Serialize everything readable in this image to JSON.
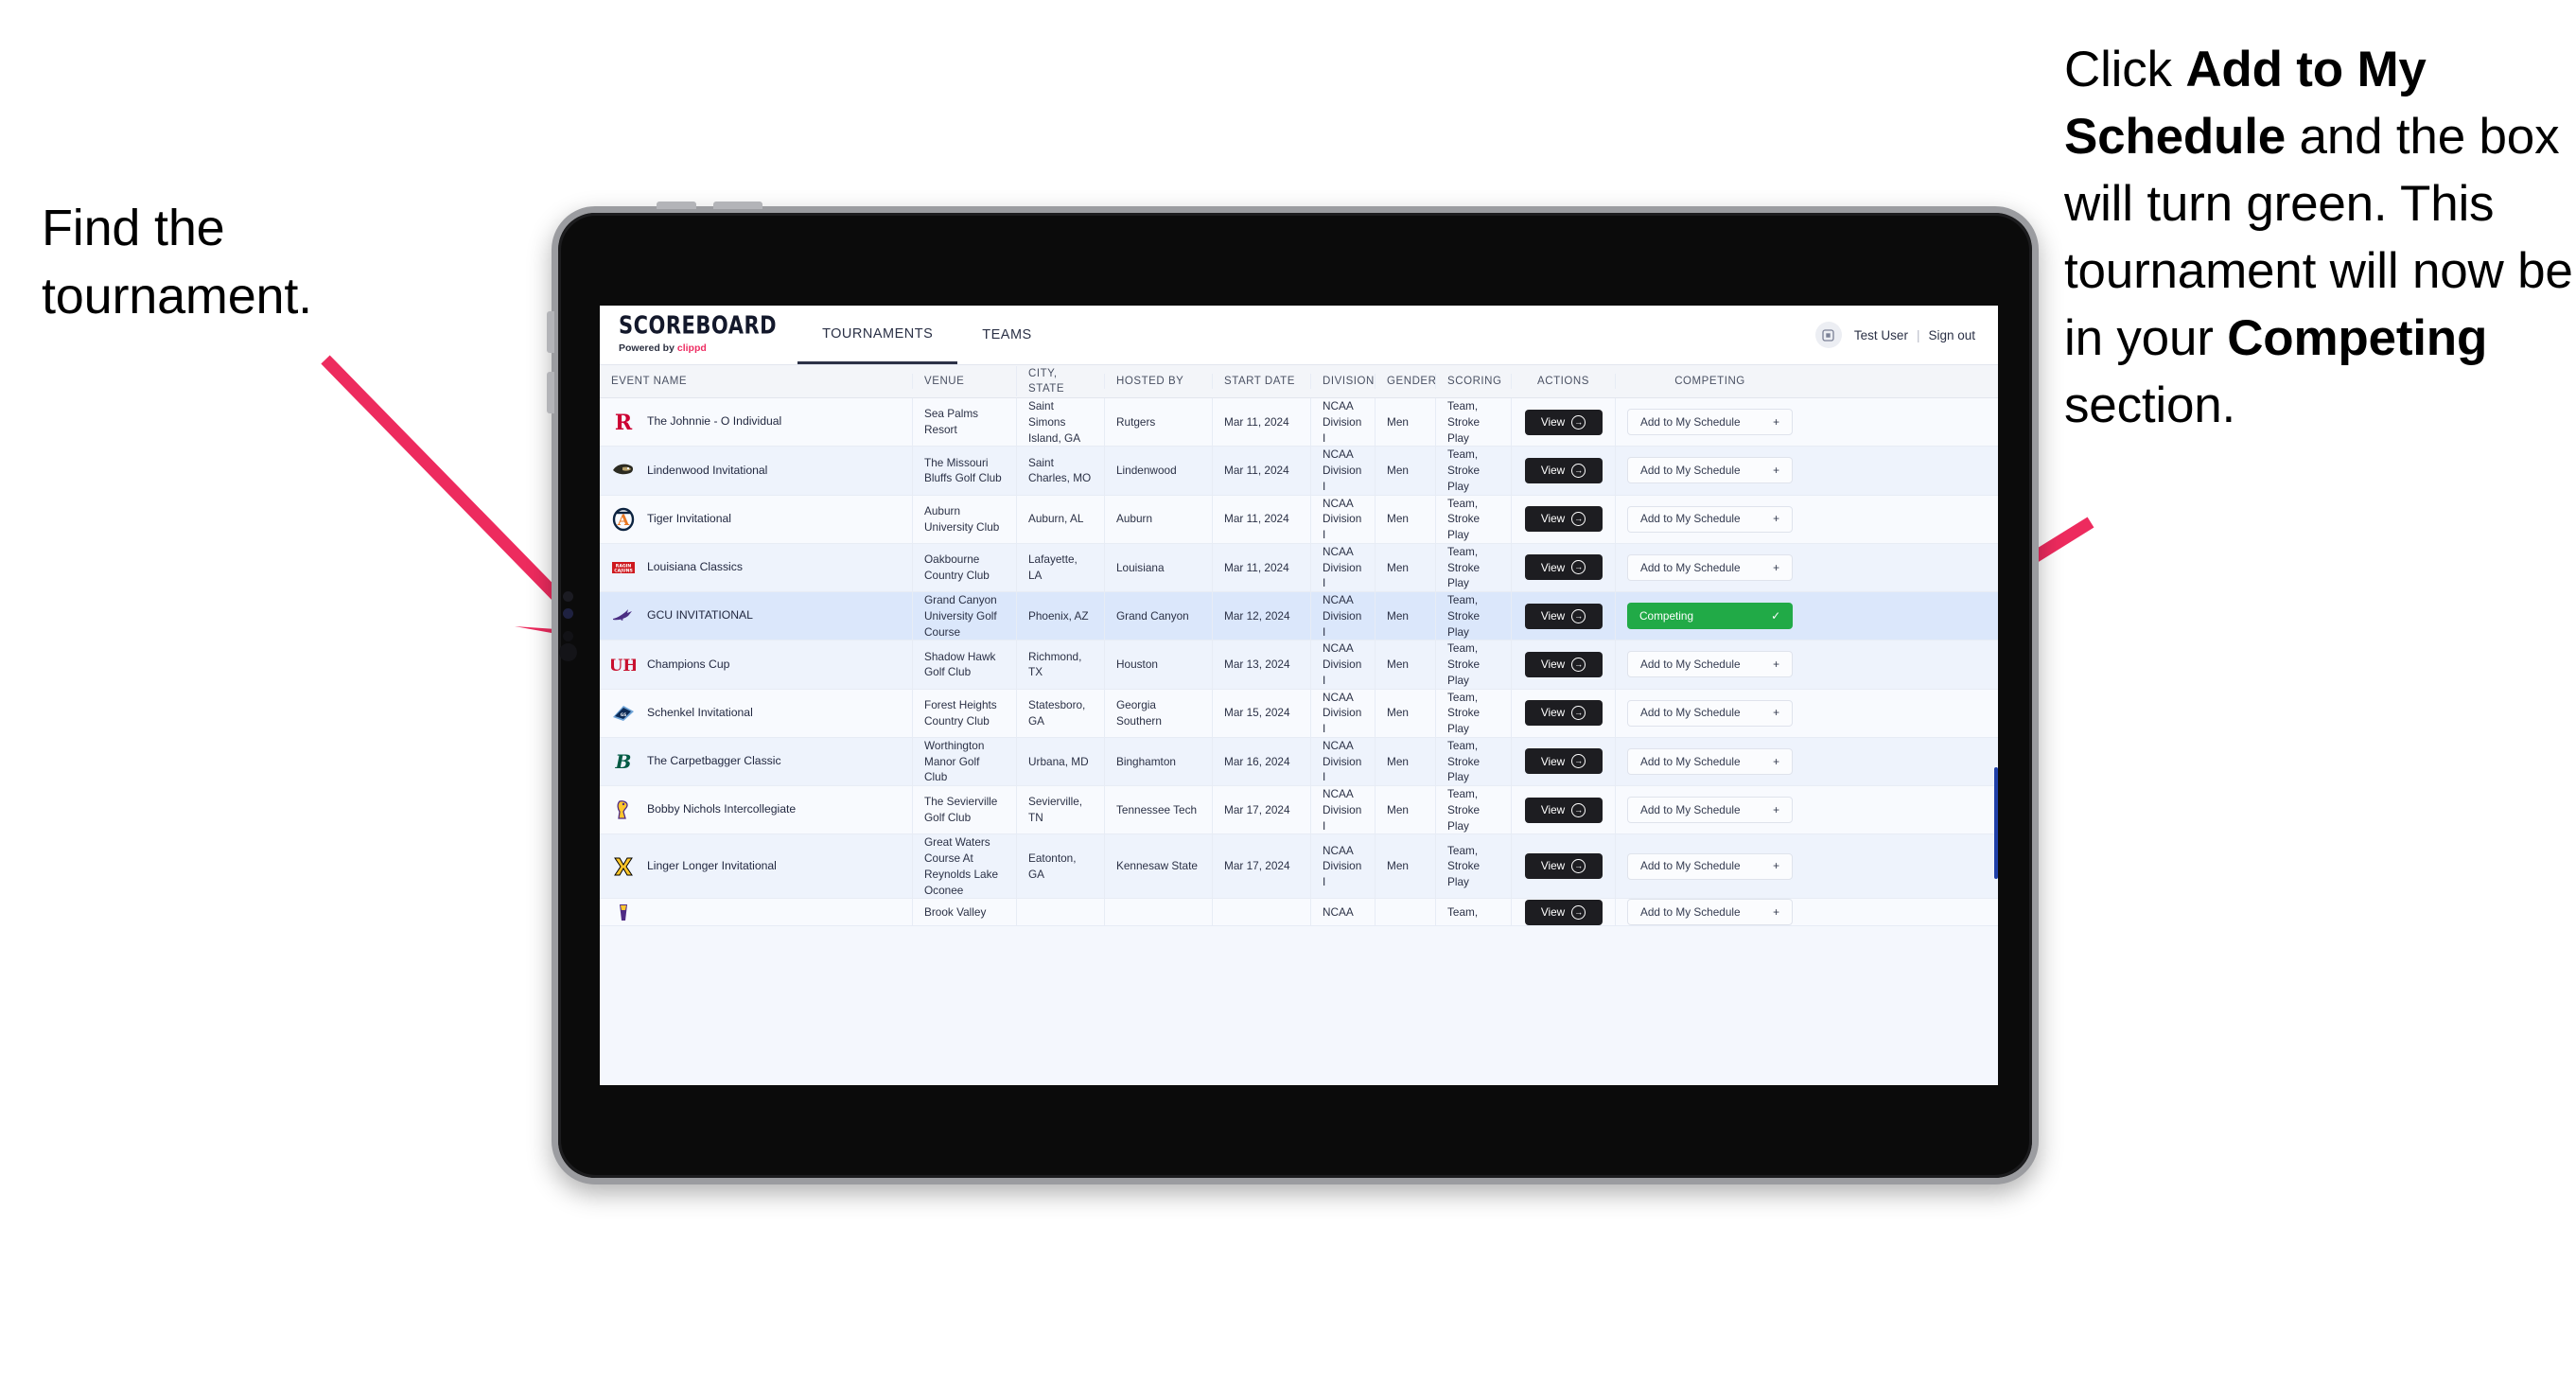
{
  "annotations": {
    "left": {
      "line1": "Find the",
      "line2": "tournament."
    },
    "right": {
      "p1_a": "Click ",
      "p1_b": "Add to My Schedule",
      "p1_c": " and the box will turn green. This tournament will now be in your ",
      "p1_d": "Competing",
      "p1_e": " section."
    },
    "arrow_color": "#ed2b5e"
  },
  "app": {
    "brand": {
      "title": "SCOREBOARD",
      "powered_prefix": "Powered by ",
      "powered_name": "clippd",
      "accent": "#ee2c62"
    },
    "nav": [
      {
        "label": "TOURNAMENTS",
        "active": true
      },
      {
        "label": "TEAMS",
        "active": false
      }
    ],
    "account": {
      "user": "Test User",
      "separator": "|",
      "sign_out": "Sign out"
    },
    "table": {
      "columns": [
        "EVENT NAME",
        "VENUE",
        "CITY, STATE",
        "HOSTED BY",
        "START DATE",
        "DIVISION",
        "GENDER",
        "SCORING",
        "ACTIONS",
        "COMPETING"
      ],
      "action_label": "View",
      "add_label": "Add to My Schedule",
      "add_glyph": "+",
      "competing_label": "Competing",
      "competing_glyph": "✓",
      "competing_color": "#21aa47",
      "rows": [
        {
          "event": "The Johnnie - O Individual",
          "venue": "Sea Palms Resort",
          "city": "Saint Simons Island, GA",
          "host": "Rutgers",
          "date": "Mar 11, 2024",
          "division": "NCAA Division I",
          "gender": "Men",
          "scoring": "Team, Stroke Play",
          "competing": false,
          "logo": "rutgers-logo"
        },
        {
          "event": "Lindenwood Invitational",
          "venue": "The Missouri Bluffs Golf Club",
          "city": "Saint Charles, MO",
          "host": "Lindenwood",
          "date": "Mar 11, 2024",
          "division": "NCAA Division I",
          "gender": "Men",
          "scoring": "Team, Stroke Play",
          "competing": false,
          "logo": "lindenwood-logo"
        },
        {
          "event": "Tiger Invitational",
          "venue": "Auburn University Club",
          "city": "Auburn, AL",
          "host": "Auburn",
          "date": "Mar 11, 2024",
          "division": "NCAA Division I",
          "gender": "Men",
          "scoring": "Team, Stroke Play",
          "competing": false,
          "logo": "auburn-logo"
        },
        {
          "event": "Louisiana Classics",
          "venue": "Oakbourne Country Club",
          "city": "Lafayette, LA",
          "host": "Louisiana",
          "date": "Mar 11, 2024",
          "division": "NCAA Division I",
          "gender": "Men",
          "scoring": "Team, Stroke Play",
          "competing": false,
          "logo": "louisiana-logo"
        },
        {
          "event": "GCU INVITATIONAL",
          "venue": "Grand Canyon University Golf Course",
          "city": "Phoenix, AZ",
          "host": "Grand Canyon",
          "date": "Mar 12, 2024",
          "division": "NCAA Division I",
          "gender": "Men",
          "scoring": "Team, Stroke Play",
          "competing": true,
          "selected": true,
          "logo": "gcu-logo"
        },
        {
          "event": "Champions Cup",
          "venue": "Shadow Hawk Golf Club",
          "city": "Richmond, TX",
          "host": "Houston",
          "date": "Mar 13, 2024",
          "division": "NCAA Division I",
          "gender": "Men",
          "scoring": "Team, Stroke Play",
          "competing": false,
          "logo": "houston-logo"
        },
        {
          "event": "Schenkel Invitational",
          "venue": "Forest Heights Country Club",
          "city": "Statesboro, GA",
          "host": "Georgia Southern",
          "date": "Mar 15, 2024",
          "division": "NCAA Division I",
          "gender": "Men",
          "scoring": "Team, Stroke Play",
          "competing": false,
          "logo": "georgia-southern-logo"
        },
        {
          "event": "The Carpetbagger Classic",
          "venue": "Worthington Manor Golf Club",
          "city": "Urbana, MD",
          "host": "Binghamton",
          "date": "Mar 16, 2024",
          "division": "NCAA Division I",
          "gender": "Men",
          "scoring": "Team, Stroke Play",
          "competing": false,
          "logo": "binghamton-logo"
        },
        {
          "event": "Bobby Nichols Intercollegiate",
          "venue": "The Sevierville Golf Club",
          "city": "Sevierville, TN",
          "host": "Tennessee Tech",
          "date": "Mar 17, 2024",
          "division": "NCAA Division I",
          "gender": "Men",
          "scoring": "Team, Stroke Play",
          "competing": false,
          "logo": "tennessee-tech-logo"
        },
        {
          "event": "Linger Longer Invitational",
          "venue": "Great Waters Course At Reynolds Lake Oconee",
          "city": "Eatonton, GA",
          "host": "Kennesaw State",
          "date": "Mar 17, 2024",
          "division": "NCAA Division I",
          "gender": "Men",
          "scoring": "Team, Stroke Play",
          "competing": false,
          "logo": "kennesaw-logo"
        },
        {
          "event": "",
          "venue": "Brook Valley",
          "city": "",
          "host": "",
          "date": "",
          "division": "NCAA",
          "gender": "",
          "scoring": "Team,",
          "competing": false,
          "partial": true,
          "logo": "partial-logo"
        }
      ]
    }
  }
}
